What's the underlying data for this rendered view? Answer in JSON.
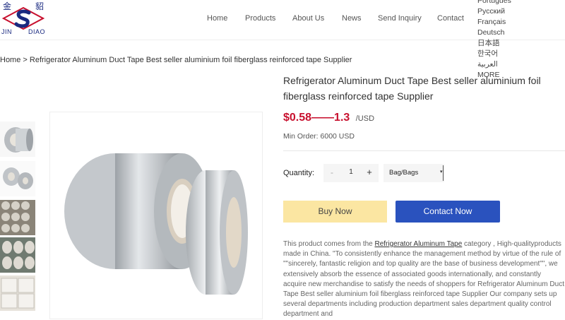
{
  "header": {
    "logo": {
      "chinese": "金貂",
      "english_left": "JIN",
      "english_right": "DIAO"
    },
    "nav": [
      "Home",
      "Products",
      "About Us",
      "News",
      "Send Inquiry",
      "Contact"
    ],
    "languages": [
      "Português",
      "Русский",
      "Français",
      "Deutsch",
      "日本語",
      "한국어",
      "العربية",
      "MORE"
    ]
  },
  "breadcrumb": {
    "home": "Home",
    "separator": ">",
    "current": "Refrigerator Aluminum Duct Tape Best seller aluminium foil fiberglass reinforced tape Supplier"
  },
  "product": {
    "title": "Refrigerator Aluminum Duct Tape Best seller aluminium foil fiberglass reinforced tape Supplier",
    "price_range": "$0.58——1.3",
    "price_unit": "/USD",
    "min_order": "Min Order: 6000 USD",
    "quantity_label": "Quantity:",
    "quantity_value": "1",
    "minus": "-",
    "plus": "+",
    "unit_selected": "Bag/Bags",
    "buy_now": "Buy Now",
    "contact_now": "Contact Now",
    "description_prefix": "This product comes from the ",
    "description_link": "Refrigerator Aluminum Tape",
    "description_rest": " category , High-qualityproducts made in China. \"To consistently enhance the management method by virtue of the rule of \"\"sincerely, fantastic religion and top quality are the base of business development\"\", we extensively absorb the essence of associated goods internationally, and constantly acquire new merchandise to satisfy the needs of shoppers for Refrigerator Aluminum Duct Tape Best seller aluminium foil fiberglass reinforced tape Supplier Our company sets up several departments including production department sales department quality control department and"
  },
  "colors": {
    "price": "#c8102e",
    "buy_bg": "#fbe6a2",
    "contact_bg": "#2a52be",
    "logo": "#1a2a80"
  }
}
